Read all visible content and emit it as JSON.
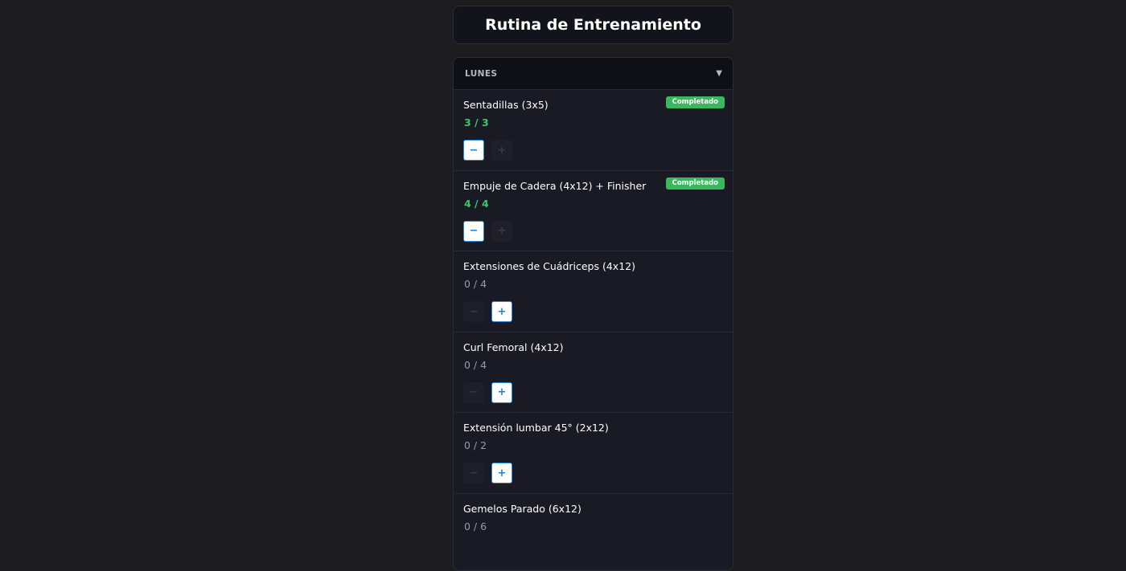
{
  "page": {
    "title": "Rutina de Entrenamiento"
  },
  "day": {
    "label": "LUNES",
    "chevron": "▼"
  },
  "colors": {
    "background": "#1c1c1f",
    "done_green": "#3ec76a",
    "badge_green": "#3ab85c",
    "button_blue": "#1d7fd6"
  },
  "icons": {
    "minus": "−",
    "plus": "+"
  },
  "exercises": [
    {
      "name": "Sentadillas (3x5)",
      "count": "3 / 3",
      "badge": "Completado"
    },
    {
      "name": "Empuje de Cadera (4x12) + Finisher",
      "count": "4 / 4",
      "badge": "Completado"
    },
    {
      "name": "Extensiones de Cuádriceps (4x12)",
      "count": "0 / 4"
    },
    {
      "name": "Curl Femoral (4x12)",
      "count": "0 / 4"
    },
    {
      "name": "Extensión lumbar 45° (2x12)",
      "count": "0 / 2"
    },
    {
      "name": "Gemelos Parado (6x12)",
      "count": "0 / 6"
    }
  ]
}
